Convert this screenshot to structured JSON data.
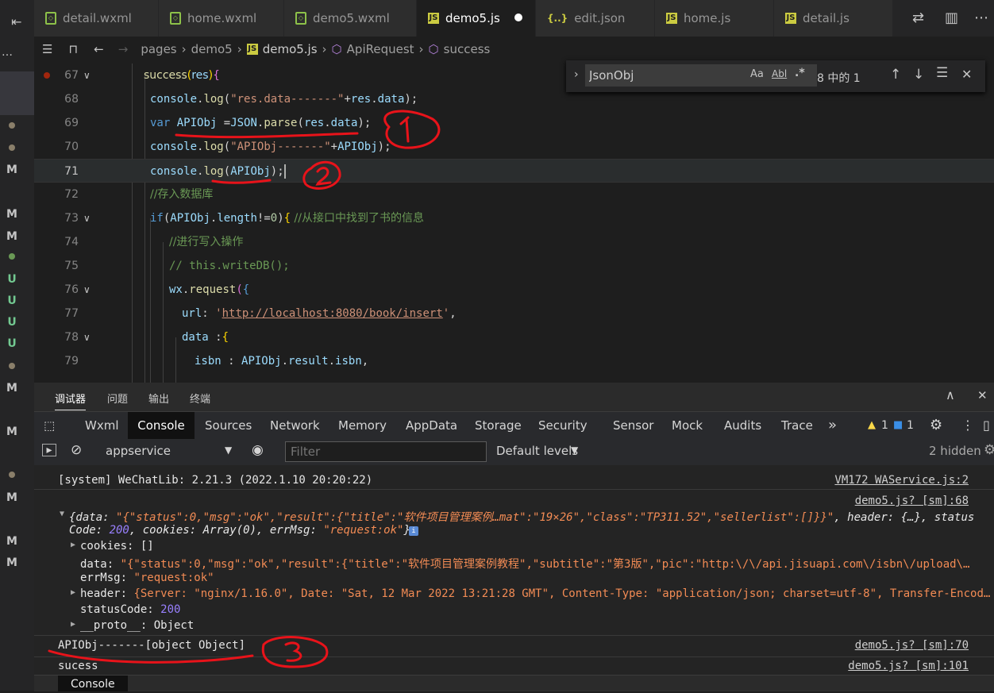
{
  "tabs": [
    {
      "name": "detail.wxml",
      "type": "wxml",
      "active": false
    },
    {
      "name": "home.wxml",
      "type": "wxml",
      "active": false
    },
    {
      "name": "demo5.wxml",
      "type": "wxml",
      "active": false
    },
    {
      "name": "demo5.js",
      "type": "js",
      "active": true
    },
    {
      "name": "edit.json",
      "type": "json",
      "active": false
    },
    {
      "name": "home.js",
      "type": "js",
      "active": false
    },
    {
      "name": "detail.js",
      "type": "js",
      "active": false
    }
  ],
  "breadcrumb": {
    "p1": "pages",
    "p2": "demo5",
    "p3": "demo5.js",
    "p4": "ApiRequest",
    "p5": "success"
  },
  "find": {
    "query": "JsonObj",
    "aa": "Aa",
    "ab": "Abl",
    "re": ".*",
    "count": "8 中的 1"
  },
  "editor": {
    "lines": [
      {
        "n": "67",
        "text": "success(res){"
      },
      {
        "n": "68",
        "text": "console.log(\"res.data-------\"+res.data);"
      },
      {
        "n": "69",
        "text": "var APIObj =JSON.parse(res.data);"
      },
      {
        "n": "70",
        "text": "console.log(\"APIObj-------\"+APIObj);"
      },
      {
        "n": "71",
        "text": "console.log(APIObj);"
      },
      {
        "n": "72",
        "text": "//存入数据库"
      },
      {
        "n": "73",
        "text": "if(APIObj.length!=0){ //从接口中找到了书的信息"
      },
      {
        "n": "74",
        "text": "//进行写入操作"
      },
      {
        "n": "75",
        "text": "// this.writeDB();"
      },
      {
        "n": "76",
        "text": "wx.request({"
      },
      {
        "n": "77",
        "text": "url: 'http://localhost:8080/book/insert',"
      },
      {
        "n": "78",
        "text": "data :{"
      },
      {
        "n": "79",
        "text": "isbn : APIObj.result.isbn,"
      }
    ]
  },
  "activity": {
    "badges": [
      "M",
      "M",
      "M",
      "U",
      "U",
      "U",
      "U",
      "M",
      "M",
      "M",
      "M",
      "M"
    ]
  },
  "devtools": {
    "top_tabs": [
      "调试器",
      "问题",
      "输出",
      "终端"
    ],
    "panel_tabs": [
      "Wxml",
      "Console",
      "Sources",
      "Network",
      "Memory",
      "AppData",
      "Storage",
      "Security",
      "Sensor",
      "Mock",
      "Audits",
      "Trace"
    ],
    "more": "»",
    "warn_count": "1",
    "info_count": "1",
    "context": "appservice",
    "filter_placeholder": "Filter",
    "levels": "Default levels",
    "hidden": "2 hidden",
    "bottom_tab": "Console"
  },
  "console": {
    "l1_text": "[system] WeChatLib: 2.21.3 (2022.1.10 20:20:22)",
    "l1_src": "VM172 WAService.js:2",
    "l2_src": "demo5.js? [sm]:68",
    "l2_a": "{data: ",
    "l2_b": "\"{\"status\":0,\"msg\":\"ok\",\"result\":{\"title\":\"软件项目管理案例…mat\":\"19×26\",\"class\":\"TP311.52\",\"sellerlist\":[]}}\"",
    "l2_c": ", header: {…}, status",
    "l2_d": "Code: ",
    "l2_e": "200",
    "l2_f": ", cookies: Array(0), errMsg: ",
    "l2_g": "\"request:ok\"",
    "l2_h": "}",
    "cookies": "cookies: []",
    "data_k": "data: ",
    "data_v": "\"{\"status\":0,\"msg\":\"ok\",\"result\":{\"title\":\"软件项目管理案例教程\",\"subtitle\":\"第3版\",\"pic\":\"http:\\/\\/api.jisuapi.com\\/isbn\\/upload\\…",
    "errmsg_k": "errMsg: ",
    "errmsg_v": "\"request:ok\"",
    "header_k": "header: ",
    "header_v": "{Server: \"nginx/1.16.0\", Date: \"Sat, 12 Mar 2022 13:21:28 GMT\", Content-Type: \"application/json; charset=utf-8\", Transfer-Encod…",
    "status_k": "statusCode: ",
    "status_v": "200",
    "proto": "__proto__: Object",
    "l3_text": "APIObj-------[object Object]",
    "l3_src": "demo5.js? [sm]:70",
    "l4_text": "sucess",
    "l4_src": "demo5.js? [sm]:101"
  },
  "colors": {
    "accent": "#007acc",
    "annotation": "#e8131a",
    "editor_bg": "#1e1e1e"
  }
}
